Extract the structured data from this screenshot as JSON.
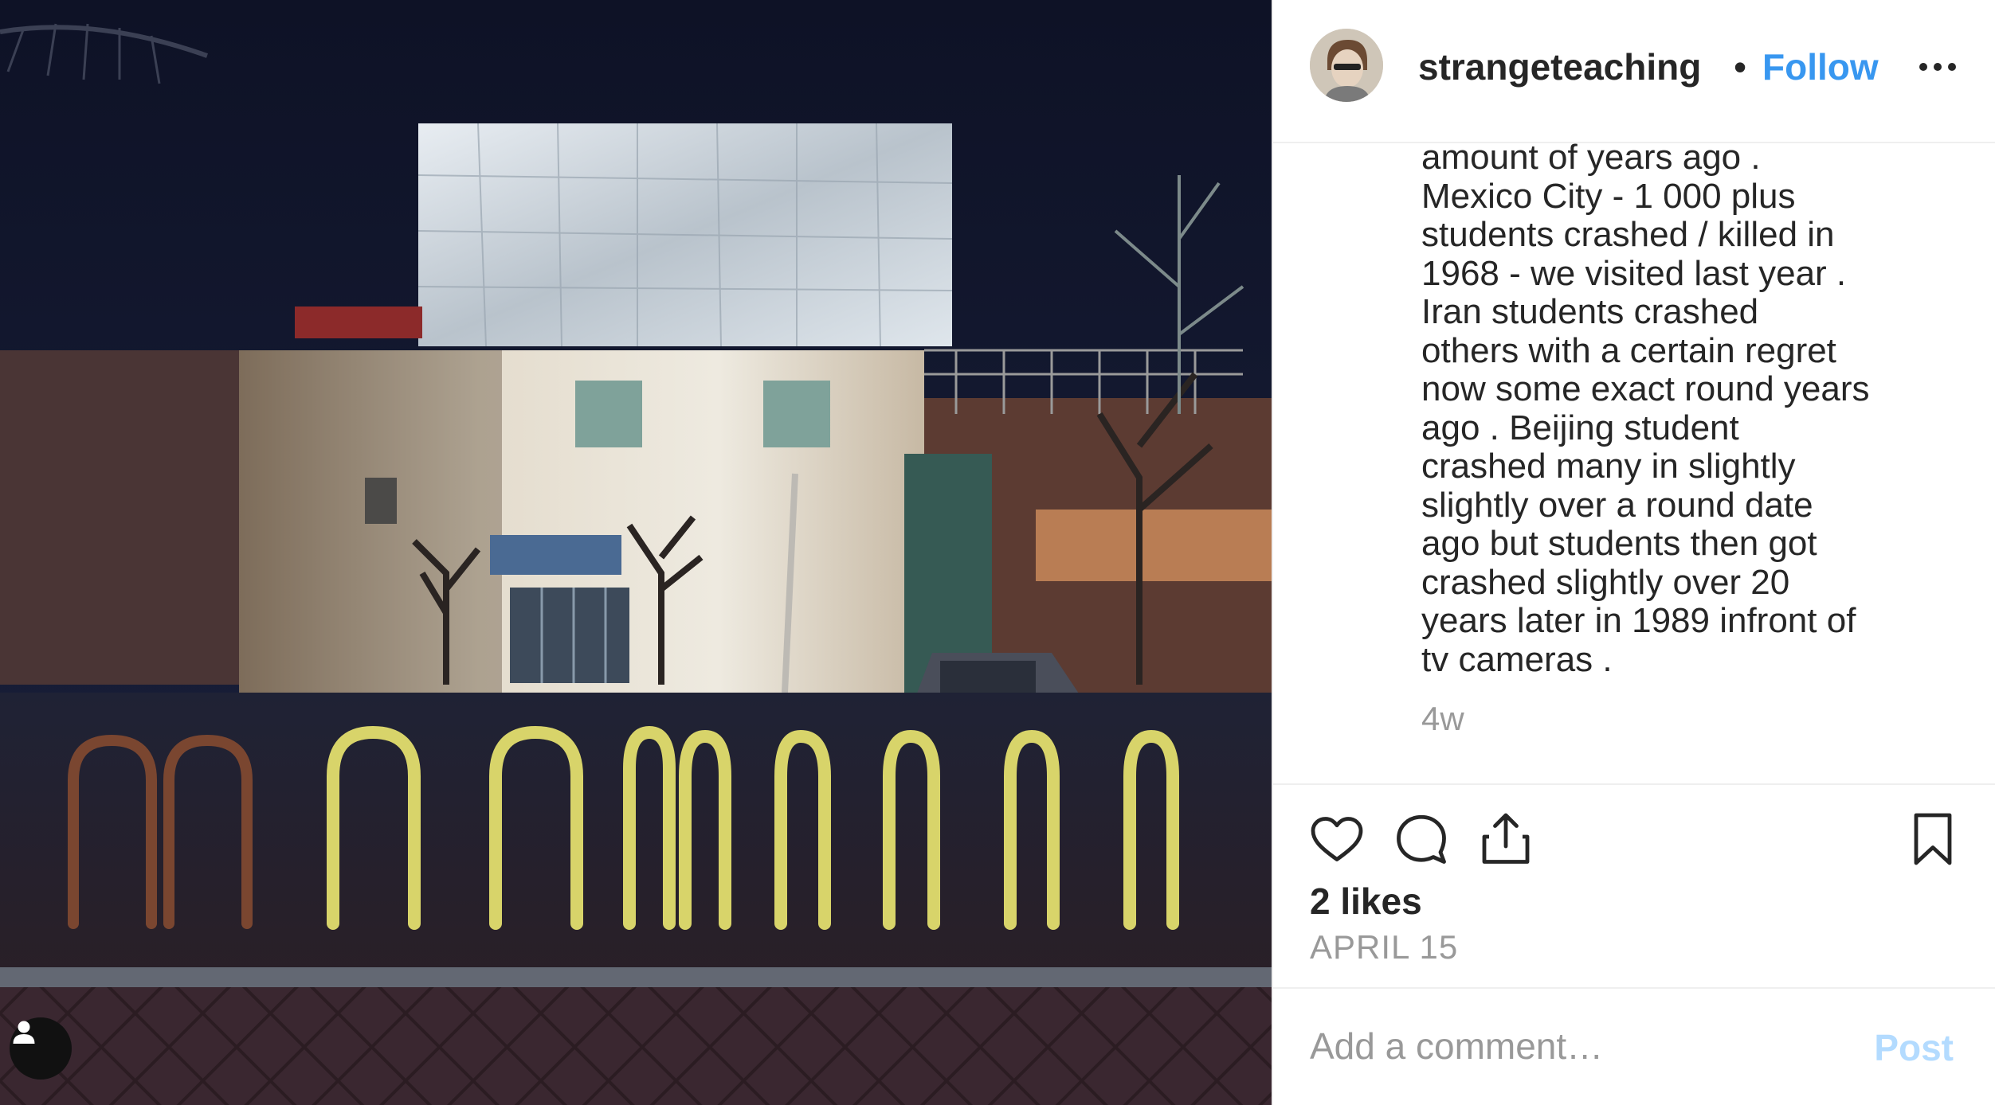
{
  "post": {
    "image_description_icon": "user-tag-icon"
  },
  "header": {
    "username": "strangeteaching",
    "separator": "•",
    "follow_label": "Follow",
    "more_icon": "ellipsis-icon"
  },
  "caption": {
    "lines": [
      "amount of years ago .",
      "Mexico City - 1 000 plus",
      "students crashed / killed in",
      "1968 - we visited last year .",
      "Iran students crashed",
      "others with a certain regret",
      "now some exact round years",
      "ago . Beijing student",
      "crashed many in slightly",
      "slightly over a round date",
      "ago but students then got",
      "crashed slightly over 20",
      "years later in 1989 infront of",
      "tv cameras ."
    ],
    "time_ago": "4w"
  },
  "actions": {
    "like_icon": "heart-icon",
    "comment_icon": "comment-icon",
    "share_icon": "share-icon",
    "save_icon": "bookmark-icon",
    "likes_text": "2 likes",
    "date_text": "APRIL 15"
  },
  "comment": {
    "placeholder": "Add a comment…",
    "post_label": "Post"
  },
  "colors": {
    "accent": "#3897f0",
    "post_disabled": "#b3dbff",
    "text_primary": "#262626",
    "text_secondary": "#999999"
  }
}
